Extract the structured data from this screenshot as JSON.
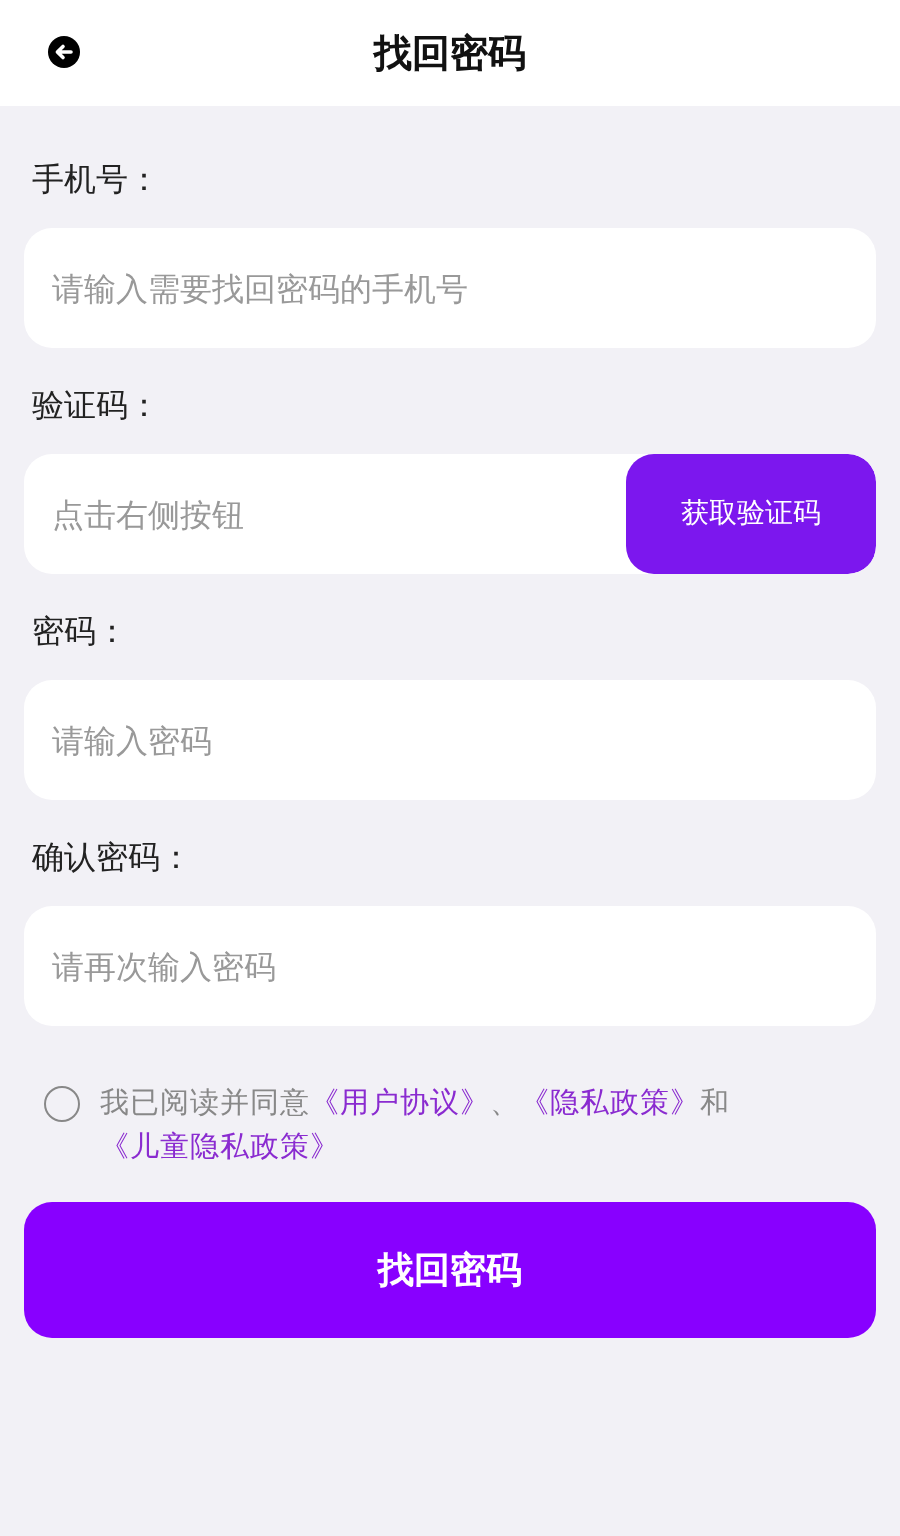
{
  "header": {
    "title": "找回密码"
  },
  "fields": [
    {
      "kind": "input",
      "label": "手机号：",
      "placeholder": "请输入需要找回密码的手机号"
    },
    {
      "kind": "code",
      "label": "验证码：",
      "placeholder": "点击右侧按钮",
      "button": "获取验证码"
    },
    {
      "kind": "input",
      "label": "密码：",
      "placeholder": "请输入密码"
    },
    {
      "kind": "input",
      "label": "确认密码：",
      "placeholder": "请再次输入密码"
    }
  ],
  "agreement": {
    "checked": false,
    "parts": [
      {
        "kind": "text",
        "text": "我已阅读并同意"
      },
      {
        "kind": "link",
        "text": "《用户协议》"
      },
      {
        "kind": "text",
        "text": "、"
      },
      {
        "kind": "link",
        "text": "《隐私政策》"
      },
      {
        "kind": "text",
        "text": "和"
      },
      {
        "kind": "link",
        "text": "《儿童隐私政策》"
      }
    ]
  },
  "submit": "找回密码"
}
